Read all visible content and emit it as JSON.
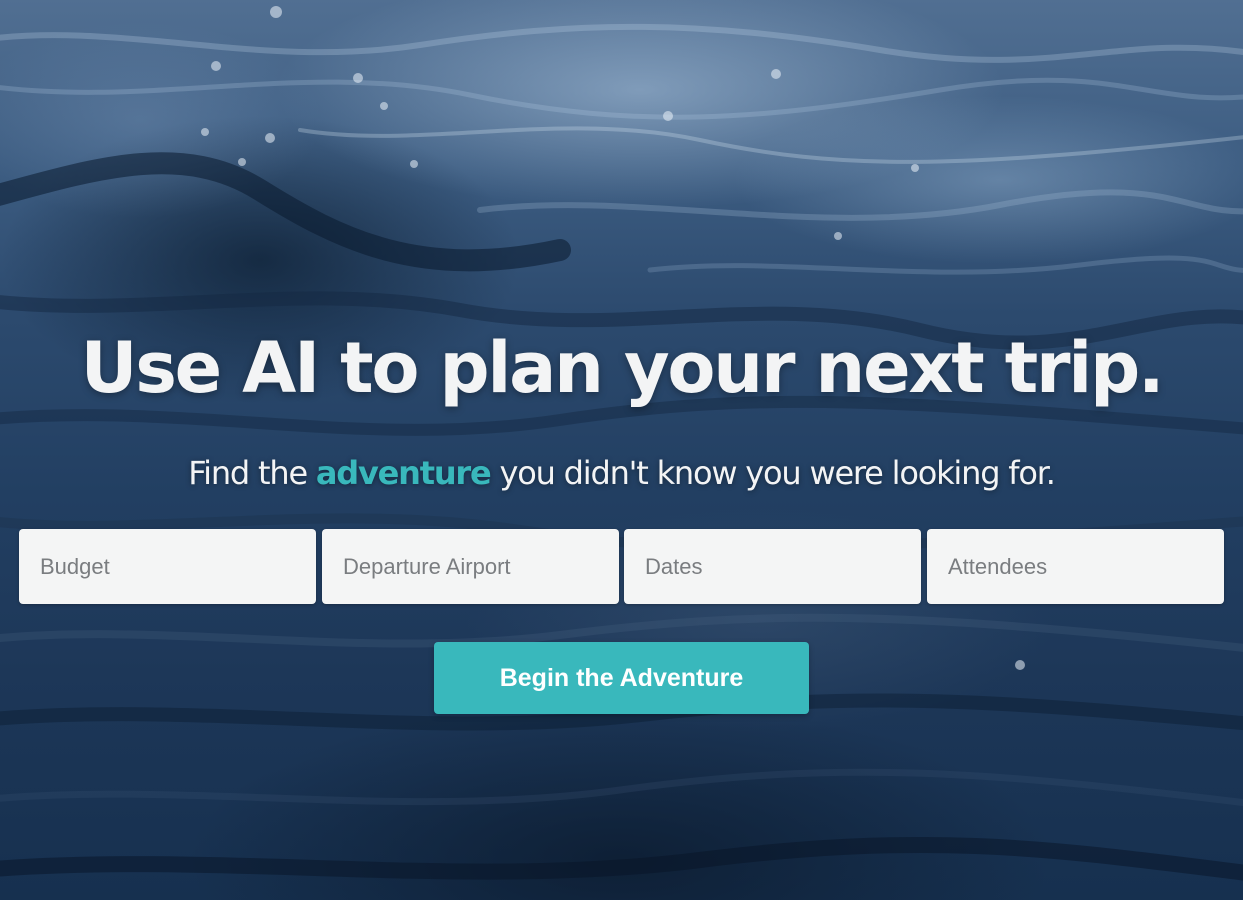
{
  "hero": {
    "background_icon": "ocean-waves-photo",
    "headline": "Use AI to plan your next trip.",
    "subhead_before": "Find the ",
    "subhead_accent": "adventure",
    "subhead_after": " you didn't know you were looking for.",
    "accent_color": "#39b8bc"
  },
  "form": {
    "budget_placeholder": "Budget",
    "departure_placeholder": "Departure Airport",
    "dates_placeholder": "Dates",
    "attendees_placeholder": "Attendees",
    "submit_label": "Begin the Adventure"
  }
}
